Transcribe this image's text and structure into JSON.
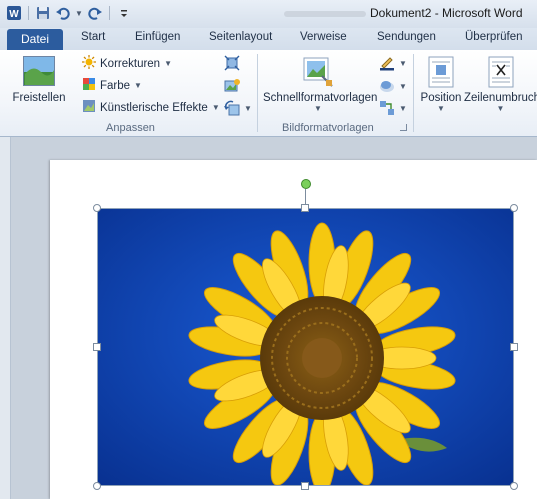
{
  "window": {
    "title": "Dokument2 - Microsoft Word"
  },
  "quick_access": {
    "icons": [
      "word-app-icon",
      "save-icon",
      "undo-icon",
      "redo-icon",
      "customize-icon"
    ]
  },
  "tabs": {
    "file": "Datei",
    "items": [
      "Start",
      "Einfügen",
      "Seitenlayout",
      "Verweise",
      "Sendungen",
      "Überprüfen"
    ]
  },
  "ribbon": {
    "adjust_group": {
      "label": "Anpassen",
      "remove_bg": "Freistellen",
      "corrections": "Korrekturen",
      "color": "Farbe",
      "artistic_effects": "Künstlerische Effekte"
    },
    "styles_group": {
      "label": "Bildformatvorlagen",
      "quick_styles": "Schnellformatvorlagen"
    },
    "arrange_group": {
      "position": "Position",
      "wrap_text": "Zeilenumbruch"
    }
  },
  "colors": {
    "file_tab": "#2c5c9e",
    "sky": "#0b3ea8",
    "petal": "#f5c810",
    "center": "#7a5412"
  }
}
